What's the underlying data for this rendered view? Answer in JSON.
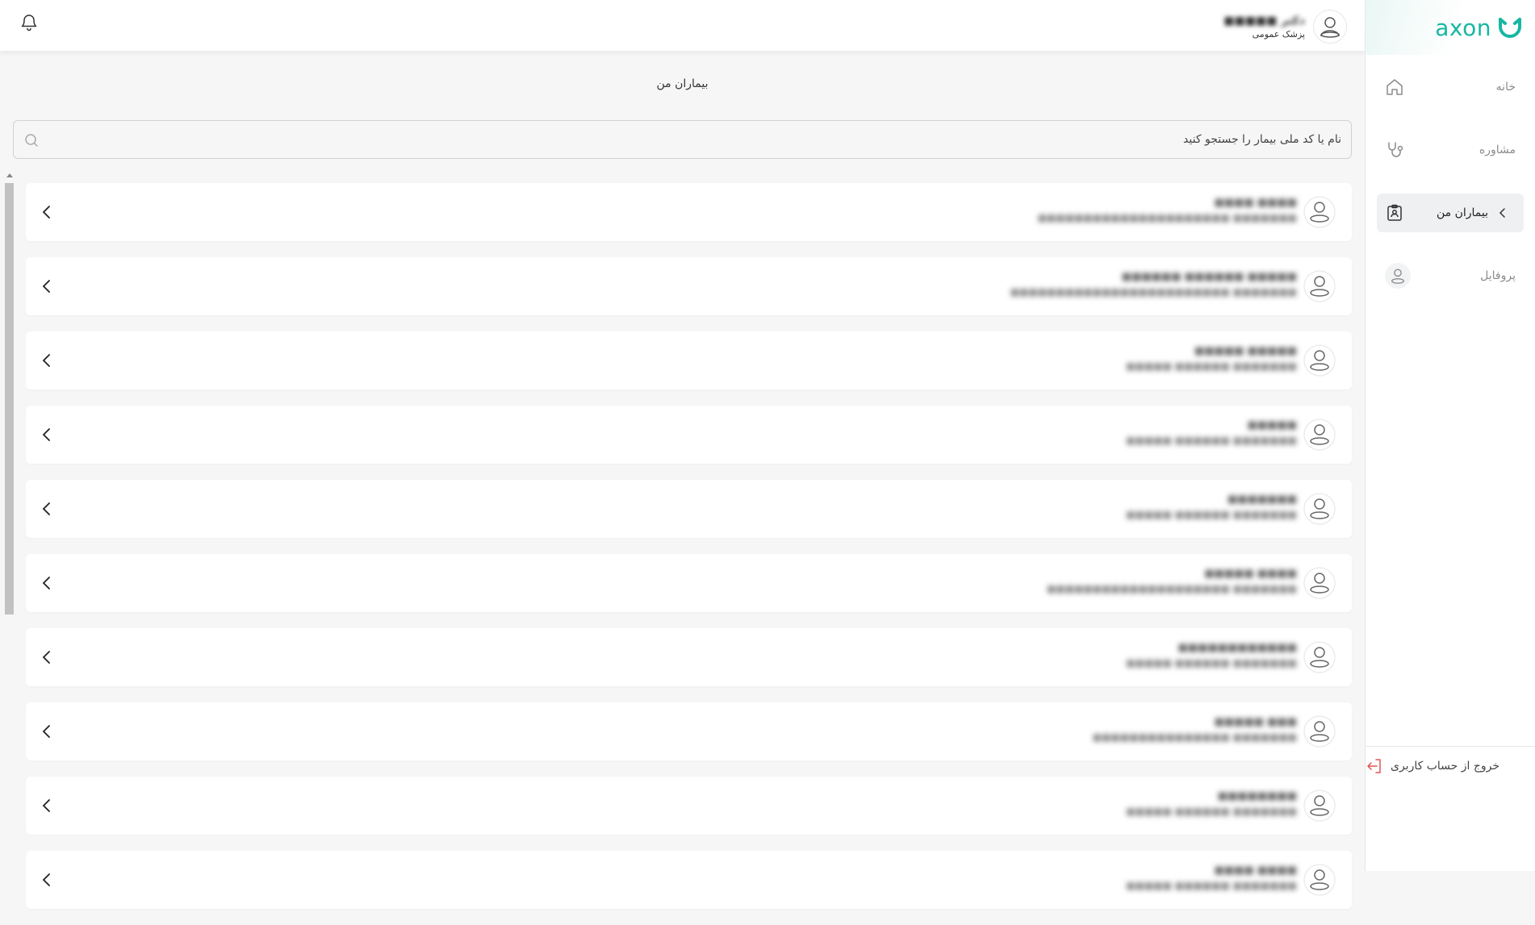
{
  "brand": {
    "logo_text": "axon",
    "accent_color": "#17b7a3"
  },
  "sidebar": {
    "items": [
      {
        "label": "خانه",
        "icon": "home-icon",
        "active": false
      },
      {
        "label": "مشاوره",
        "icon": "stethoscope-icon",
        "active": false
      },
      {
        "label": "بیماران من",
        "icon": "patient-file-icon",
        "active": true
      },
      {
        "label": "پروفایل",
        "icon": "user-icon",
        "active": false
      }
    ],
    "logout_label": "خروج از حساب کاربری"
  },
  "header": {
    "user_name": "دکتر ■■■■■",
    "user_role": "پزشک عمومی"
  },
  "main": {
    "title": "بیماران من",
    "search": {
      "placeholder": "نام یا کد ملی بیمار را جستجو کنید",
      "value": ""
    },
    "patients": [
      {
        "name": "■■■■ ■■■■",
        "sub": "■■■■■■■ ■■■■■■■■■■■■■■■■■■■■■"
      },
      {
        "name": "■■■■■ ■■■■■■ ■■■■■■",
        "sub": "■■■■■■■ ■■■■■■■■■■■■■■■■■■■■■■■■"
      },
      {
        "name": "■■■■■ ■■■■■",
        "sub": "■■■■■■■ ■■■■■■ ■■■■■"
      },
      {
        "name": "■■■■■",
        "sub": "■■■■■■■ ■■■■■■ ■■■■■"
      },
      {
        "name": "■■■■■■■",
        "sub": "■■■■■■■ ■■■■■■ ■■■■■"
      },
      {
        "name": "■■■■ ■■■■■",
        "sub": "■■■■■■■ ■■■■■■■■■■■■■■■■■■■■"
      },
      {
        "name": "■■■■■■■■■■■■",
        "sub": "■■■■■■■ ■■■■■■ ■■■■■"
      },
      {
        "name": "■■■ ■■■■■",
        "sub": "■■■■■■■ ■■■■■■■■■■■■■■■"
      },
      {
        "name": "■■■■■■■■",
        "sub": "■■■■■■■ ■■■■■■ ■■■■■"
      },
      {
        "name": "■■■■ ■■■■",
        "sub": "■■■■■■■ ■■■■■■ ■■■■■"
      }
    ]
  }
}
